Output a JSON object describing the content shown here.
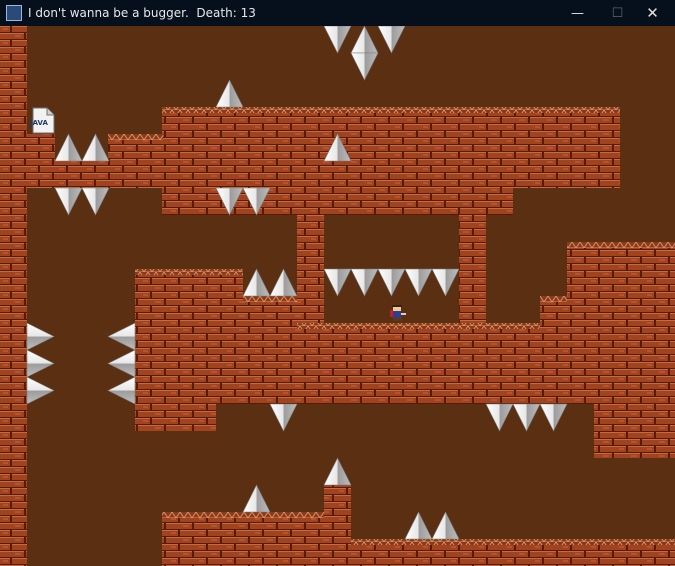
{
  "window": {
    "title": "I don't wanna be a bugger.",
    "death_label": "Death:",
    "death_count": "13"
  },
  "controls": {
    "minimize": "—",
    "maximize": "☐",
    "close": "✕"
  },
  "game": {
    "save_point_label": "JAVA",
    "colors": {
      "background": "#5a2f12",
      "brick": "#a1431f",
      "brick_dark": "#6b2410",
      "mortar": "#e8a070",
      "spike_light": "#f4f4f4",
      "spike_dark": "#9a9a9a"
    }
  }
}
